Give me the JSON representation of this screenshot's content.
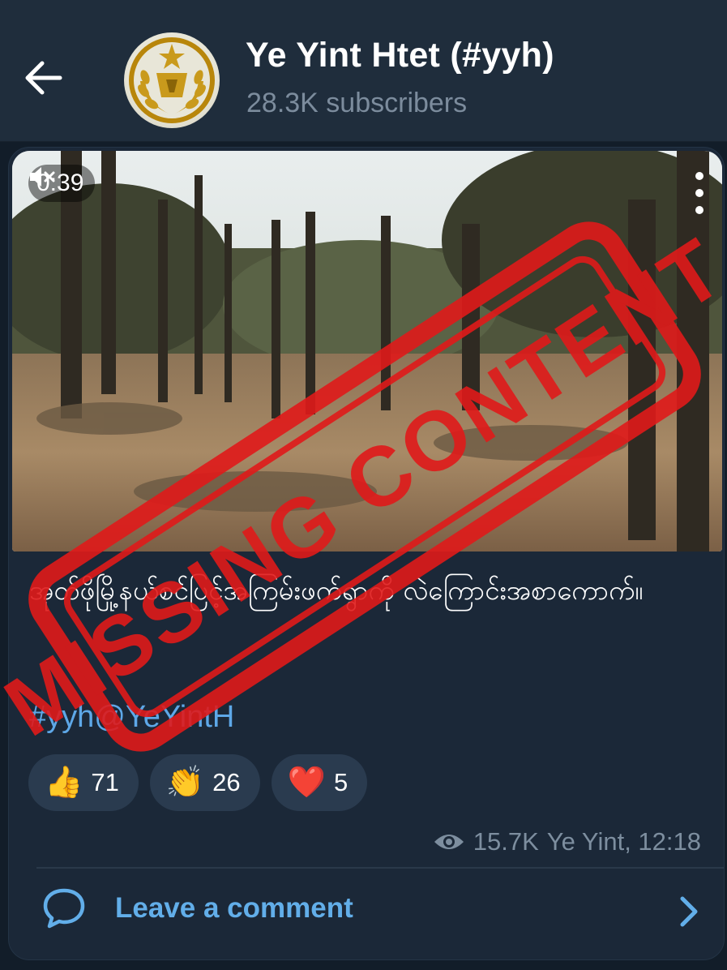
{
  "header": {
    "channel_name": "Ye Yint Htet (#yyh)",
    "subscribers": "28.3K subscribers"
  },
  "video": {
    "duration": "0:39",
    "muted": true
  },
  "message": {
    "caption": "အုတ်ဖိုမြို့နယ်စင်ပြင့်အကြမ်းဖက်ရွာကို လဲကြောင်းအစာကောက်။",
    "hashtag": "#yyh@YeYintH",
    "reactions": [
      {
        "emoji": "👍",
        "count": "71",
        "icon": "thumbs-up-icon"
      },
      {
        "emoji": "👏",
        "count": "26",
        "icon": "clapping-hands-icon"
      },
      {
        "emoji": "❤️",
        "count": "5",
        "icon": "heart-icon"
      }
    ],
    "views": "15.7K",
    "author_time": "Ye Yint, 12:18"
  },
  "comment": {
    "label": "Leave a comment"
  },
  "stamp": {
    "text": "MISSING CONTENT",
    "color": "#e01a1a"
  },
  "colors": {
    "accent_link": "#5ea8e8",
    "header_bg": "#1f2d3c",
    "bubble_bg": "#1b2838"
  }
}
